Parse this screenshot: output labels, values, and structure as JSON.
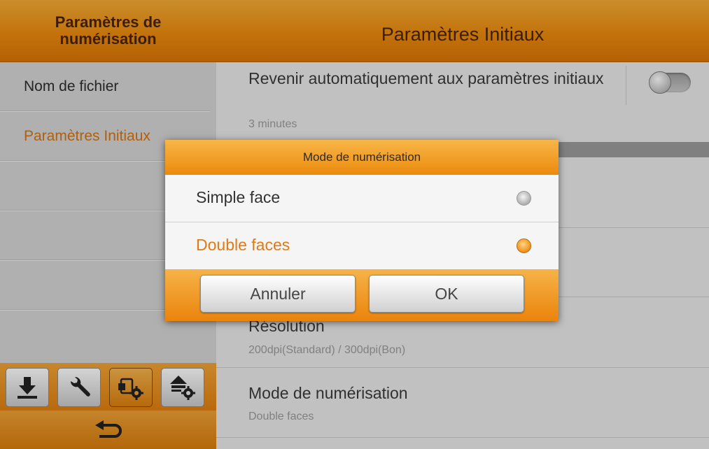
{
  "sidebar": {
    "title": "Paramètres de numérisation",
    "items": [
      {
        "label": "Nom de fichier"
      },
      {
        "label": "Paramètres Initiaux",
        "active": true
      },
      {
        "label": ""
      },
      {
        "label": ""
      },
      {
        "label": ""
      }
    ],
    "tabs": [
      {
        "icon": "download-icon"
      },
      {
        "icon": "wrench-icon"
      },
      {
        "icon": "scanner-settings-icon",
        "selected": true
      },
      {
        "icon": "upload-settings-icon"
      }
    ],
    "back_icon": "back-arrow-icon"
  },
  "main": {
    "title": "Paramètres Initiaux",
    "settings": [
      {
        "title": "Revenir automatiquement aux paramètres initiaux",
        "subtitle": "3 minutes",
        "toggle": false
      },
      {
        "title": "Résolution",
        "subtitle": "200dpi(Standard) / 300dpi(Bon)"
      },
      {
        "title": "Mode de numérisation",
        "subtitle": "Double faces"
      }
    ]
  },
  "dialog": {
    "title": "Mode de numérisation",
    "options": [
      {
        "label": "Simple face",
        "selected": false
      },
      {
        "label": "Double faces",
        "selected": true
      }
    ],
    "cancel_label": "Annuler",
    "ok_label": "OK"
  },
  "colors": {
    "accent": "#EB8A0E",
    "selected_text": "#E17A14",
    "header_text": "#4A2500"
  }
}
